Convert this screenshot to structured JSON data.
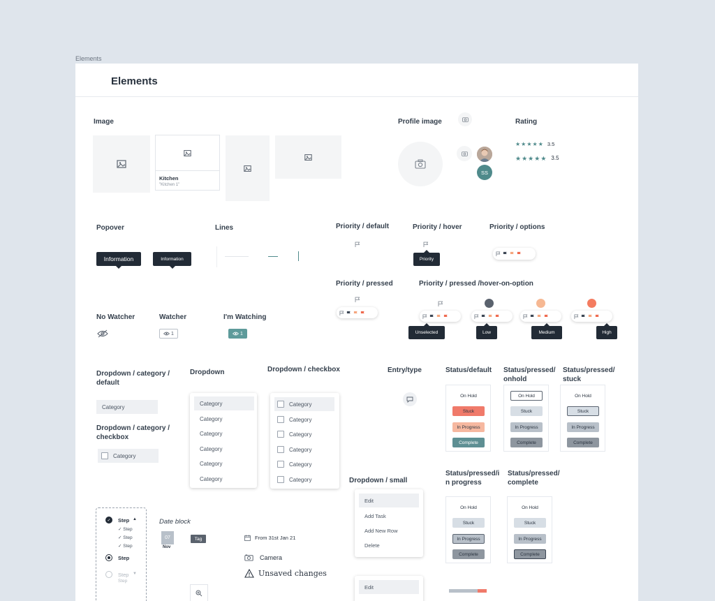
{
  "frame_label": "Elements",
  "page_title": "Elements",
  "sections": {
    "image": "Image",
    "profile_image": "Profile image",
    "rating": "Rating",
    "popover": "Popover",
    "lines": "Lines",
    "priority_default": "Priority / default",
    "priority_hover": "Priority / hover",
    "priority_options": "Priority / options",
    "priority_pressed": "Priority / pressed",
    "priority_pressed_hover": "Priority / pressed /hover-on-option",
    "no_watcher": "No Watcher",
    "watcher": "Watcher",
    "im_watching": "I'm Watching",
    "dropdown_category_default": "Dropdown / category / default",
    "dropdown": "Dropdown",
    "dropdown_checkbox": "Dropdown / checkbox",
    "entry_type": "Entry/type",
    "status_default": "Status/default",
    "status_pressed_onhold": "Status/pressed/ onhold",
    "status_pressed_stuck": "Status/pressed/ stuck",
    "dropdown_category_checkbox": "Dropdown / category / checkbox",
    "dropdown_small": "Dropdown / small",
    "status_pressed_inprogress": "Status/pressed/i n progress",
    "status_pressed_complete": "Status/pressed/ complete",
    "date_block": "Date block"
  },
  "image_card": {
    "title": "Kitchen",
    "subtitle": "\"Kitchen 1\""
  },
  "avatar_initials": "SS",
  "rating_values": [
    "3.5",
    "3.5"
  ],
  "popover": {
    "large": "Information",
    "small": "Information"
  },
  "priority": {
    "hover_tip": "Priority",
    "tips": [
      "Unselected",
      "Low",
      "Medium",
      "High"
    ]
  },
  "watcher_count": "1",
  "watching_count": "1",
  "category_label": "Category",
  "dropdown_items": [
    "Category",
    "Category",
    "Category",
    "Category",
    "Category",
    "Category"
  ],
  "checkbox_items": [
    "Category",
    "Category",
    "Category",
    "Category",
    "Category",
    "Category"
  ],
  "status_labels": [
    "On Hold",
    "Stuck",
    "In Progress",
    "Complete"
  ],
  "small_dropdown": [
    "Edit",
    "Add Task",
    "Add New Row",
    "Delete"
  ],
  "small_dropdown_2": [
    "Edit"
  ],
  "stepper": {
    "steps": [
      "Step",
      "Step",
      "Step",
      "Step",
      "Step",
      "Step"
    ],
    "faded": [
      "Step",
      "Step"
    ]
  },
  "date": {
    "day": "07",
    "month": "Nov",
    "tag": "Tag"
  },
  "date_range": "From 31st Jan 21",
  "camera_label": "Camera",
  "unsaved": "Unsaved changes",
  "colors": {
    "teal": "#4f8a8b",
    "stuck": "#f07a6a",
    "inprogress": "#f6b8a0",
    "complete": "#5e8f93",
    "dark": "#222b36"
  },
  "progress": {
    "value": 0.75
  }
}
